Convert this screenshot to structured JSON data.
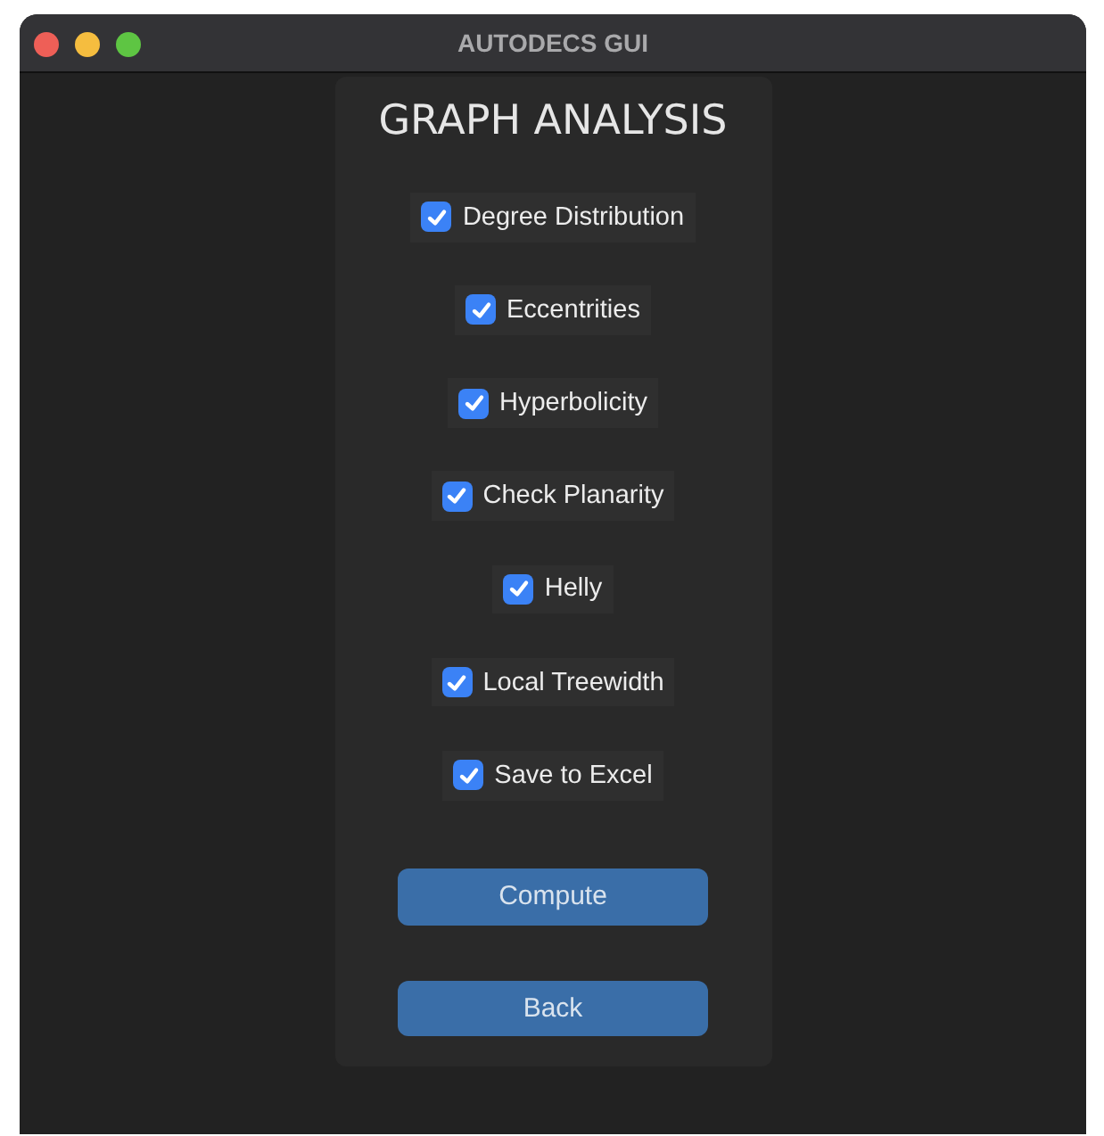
{
  "window": {
    "title": "AUTODECS GUI"
  },
  "heading": "GRAPH ANALYSIS",
  "options": [
    {
      "label": "Degree Distribution",
      "checked": true
    },
    {
      "label": "Eccentrities",
      "checked": true
    },
    {
      "label": "Hyperbolicity",
      "checked": true
    },
    {
      "label": "Check Planarity",
      "checked": true
    },
    {
      "label": "Helly",
      "checked": true
    },
    {
      "label": "Local Treewidth",
      "checked": true
    },
    {
      "label": "Save to Excel",
      "checked": true
    }
  ],
  "buttons": [
    "Compute",
    "Back"
  ]
}
